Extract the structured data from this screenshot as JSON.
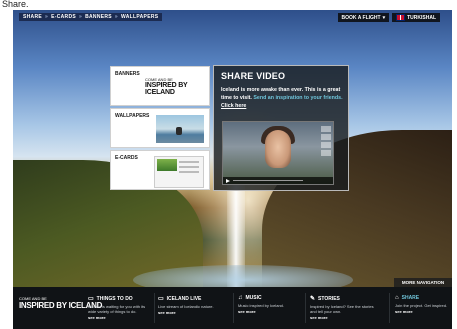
{
  "caption": "Share.",
  "topbar": {
    "breadcrumb": [
      "SHARE",
      "E-CARDS",
      "BANNERS",
      "WALLPAPERS"
    ],
    "breadcrumb_sep": "»",
    "book_flight": "BOOK A FLIGHT",
    "language": "TURKISHAL"
  },
  "panel": {
    "banners": "BANNERS",
    "wallpapers": "WALLPAPERS",
    "ecards": "E-CARDS",
    "brand_line1": "COME AND BE",
    "brand_line2": "INSPIRED BY ICELAND",
    "share_title": "SHARE VIDEO",
    "share_text": "Iceland is more awake than ever. This is a great time to visit.",
    "share_link": "Send an inspiration to your friends.",
    "share_click": "Click here"
  },
  "more_navigation": "MORE NAVIGATION",
  "footer": {
    "brand_line1": "COME AND BE",
    "brand_line2": "INSPIRED BY ICELAND",
    "items": [
      {
        "icon": "▭",
        "title": "THINGS TO DO",
        "desc": "Iceland is waiting for you with its wide variety of things to do.",
        "more": "see more"
      },
      {
        "icon": "▭",
        "title": "ICELAND LIVE",
        "desc": "Live stream of Icelandic nature.",
        "more": "see more"
      },
      {
        "icon": "♫",
        "title": "MUSIC",
        "desc": "Music inspired by Iceland.",
        "more": "see more"
      },
      {
        "icon": "✎",
        "title": "STORIES",
        "desc": "Inspired by Iceland? See the stories and tell your own.",
        "more": "see more"
      },
      {
        "icon": "⌂",
        "title": "SHARE",
        "desc": "Join the project. Get inspired.",
        "more": "see more"
      }
    ]
  }
}
